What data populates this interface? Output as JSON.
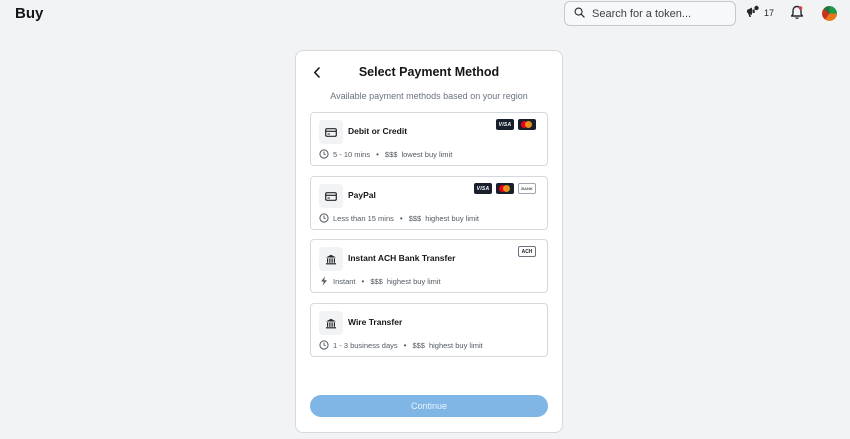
{
  "header": {
    "title": "Buy",
    "search_placeholder": "Search for a token...",
    "notification_count": "17"
  },
  "card": {
    "title": "Select Payment Method",
    "subtitle": "Available payment methods based on your region",
    "methods": [
      {
        "name": "Debit or Credit",
        "time": "5 - 10 mins",
        "fee": "$$$",
        "limit": "lowest buy limit",
        "logos": [
          "VISA",
          "mastercard"
        ]
      },
      {
        "name": "PayPal",
        "time": "Less than 15 mins",
        "fee": "$$$",
        "limit": "highest buy limit",
        "logos": [
          "VISA",
          "mastercard",
          "BANK"
        ]
      },
      {
        "name": "Instant ACH Bank Transfer",
        "time": "Instant",
        "fee": "$$$",
        "limit": "highest buy limit",
        "logos": [
          "ACH"
        ]
      },
      {
        "name": "Wire Transfer",
        "time": "1 - 3 business days",
        "fee": "$$$",
        "limit": "highest buy limit",
        "logos": []
      }
    ],
    "continue_label": "Continue"
  },
  "colors": {
    "accent_disabled": "#7fb6e6",
    "background": "#f2f3f4"
  }
}
